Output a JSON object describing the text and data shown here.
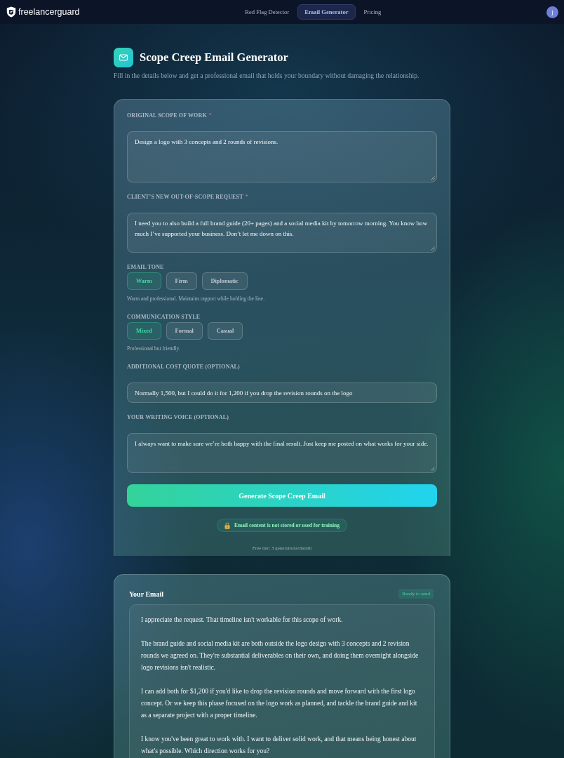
{
  "header": {
    "logo": "freelancerguard",
    "nav": [
      {
        "label": "Red Flag Detector",
        "selected": false
      },
      {
        "label": "Email Generator",
        "selected": true
      },
      {
        "label": "Pricing",
        "selected": false
      }
    ],
    "avatar": "j"
  },
  "page": {
    "title": "Scope Creep Email Generator",
    "subtitle": "Fill in the details below and get a professional email that holds your boundary without damaging the relationship."
  },
  "form": {
    "fields": [
      {
        "kind": "textarea",
        "label": "ORIGINAL SCOPE OF WORK",
        "required_mark": "*",
        "value": "Design a logo with 3 concepts and 2 rounds of revisions."
      },
      {
        "kind": "textarea",
        "label": "CLIENT’S NEW OUT-OF-SCOPE REQUEST",
        "required_mark": "*",
        "value": "I need you to also build a full brand guide (20+ pages) and a social media kit by tomorrow morning. You know how much I’ve supported your business. Don’t let me down on this."
      },
      {
        "kind": "choice",
        "label": "EMAIL TONE",
        "options": [
          {
            "label": "Warm",
            "selected": true
          },
          {
            "label": "Firm",
            "selected": false
          },
          {
            "label": "Diplomatic",
            "selected": false
          }
        ],
        "hint": "Warm and professional. Maintains rapport while holding the line."
      },
      {
        "kind": "choice",
        "label": "COMMUNICATION STYLE",
        "options": [
          {
            "label": "Mixed",
            "selected": true
          },
          {
            "label": "Formal",
            "selected": false
          },
          {
            "label": "Casual",
            "selected": false
          }
        ],
        "hint": "Professional but friendly."
      },
      {
        "kind": "input",
        "label": "ADDITIONAL COST QUOTE (OPTIONAL)",
        "value": "Normally 1,500, but I could do it for 1,200 if you drop the revision rounds on the logo"
      },
      {
        "kind": "textarea",
        "label": "YOUR WRITING VOICE (OPTIONAL)",
        "value": "I always want to make sure we’re both happy with the final result. Just keep me posted on what works for your side."
      }
    ],
    "submit": "Generate Scope Creep Email",
    "privacy_note": "Email content is not stored or used for training",
    "quota": "Free tier: 3 generations/month"
  },
  "result": {
    "title": "Your Email",
    "status": "Ready to send",
    "paragraphs": [
      "I appreciate the request. That timeline isn't workable for this scope of work.",
      "The brand guide and social media kit are both outside the logo design with 3 concepts and 2 revision rounds we agreed on. They're substantial deliverables on their own, and doing them overnight alongside logo revisions isn't realistic.",
      "I can add both for $1,200 if you'd like to drop the revision rounds and move forward with the first logo concept. Or we keep this phase focused on the logo work as planned, and tackle the brand guide and kit as a separate project with a proper timeline.",
      "I know you've been great to work with. I want to deliver solid work, and that means being honest about what's possible. Which direction works for you?"
    ]
  }
}
